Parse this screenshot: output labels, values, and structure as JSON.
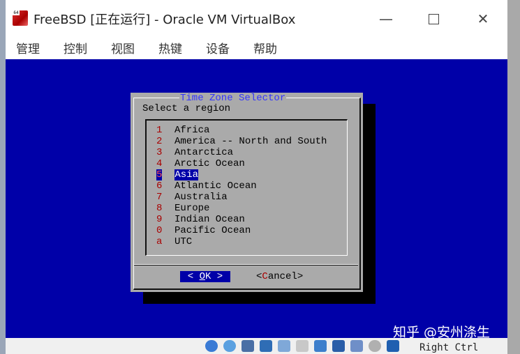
{
  "window": {
    "title": "FreeBSD [正在运行] - Oracle VM VirtualBox",
    "icon_badge": "64",
    "controls": {
      "minimize": "—",
      "close": "✕"
    }
  },
  "menubar": {
    "items": [
      "管理",
      "控制",
      "视图",
      "热键",
      "设备",
      "帮助"
    ]
  },
  "dialog": {
    "title": "Time Zone Selector",
    "prompt": "Select a region",
    "items": [
      {
        "key": "1",
        "label": "Africa"
      },
      {
        "key": "2",
        "label": "America -- North and South"
      },
      {
        "key": "3",
        "label": "Antarctica"
      },
      {
        "key": "4",
        "label": "Arctic Ocean"
      },
      {
        "key": "5",
        "label": "Asia"
      },
      {
        "key": "6",
        "label": "Atlantic Ocean"
      },
      {
        "key": "7",
        "label": "Australia"
      },
      {
        "key": "8",
        "label": "Europe"
      },
      {
        "key": "9",
        "label": "Indian Ocean"
      },
      {
        "key": "0",
        "label": "Pacific Ocean"
      },
      {
        "key": "a",
        "label": "UTC"
      }
    ],
    "selected_key": "5",
    "ok": {
      "left": "< ",
      "hot": "O",
      "rest": "K",
      "right": " >"
    },
    "cancel": {
      "left": "<",
      "hot": "C",
      "rest": "ancel",
      "right": ">"
    }
  },
  "statusbar": {
    "host_key": "Right Ctrl",
    "icons": [
      "hard-disk-icon",
      "optical-drive-icon",
      "audio-icon",
      "network-icon",
      "usb-icon",
      "shared-folders-icon",
      "display-icon",
      "recording-icon",
      "vt-x-icon",
      "mouse-integration-icon",
      "keyboard-capture-icon"
    ]
  },
  "watermark": "知乎 @安州涤生",
  "colors": {
    "vm_background": "#0000a8",
    "dialog_background": "#aaaaaa",
    "dialog_title": "#3434fc",
    "hotkey_red": "#a80000",
    "selection": "#0000a8"
  }
}
